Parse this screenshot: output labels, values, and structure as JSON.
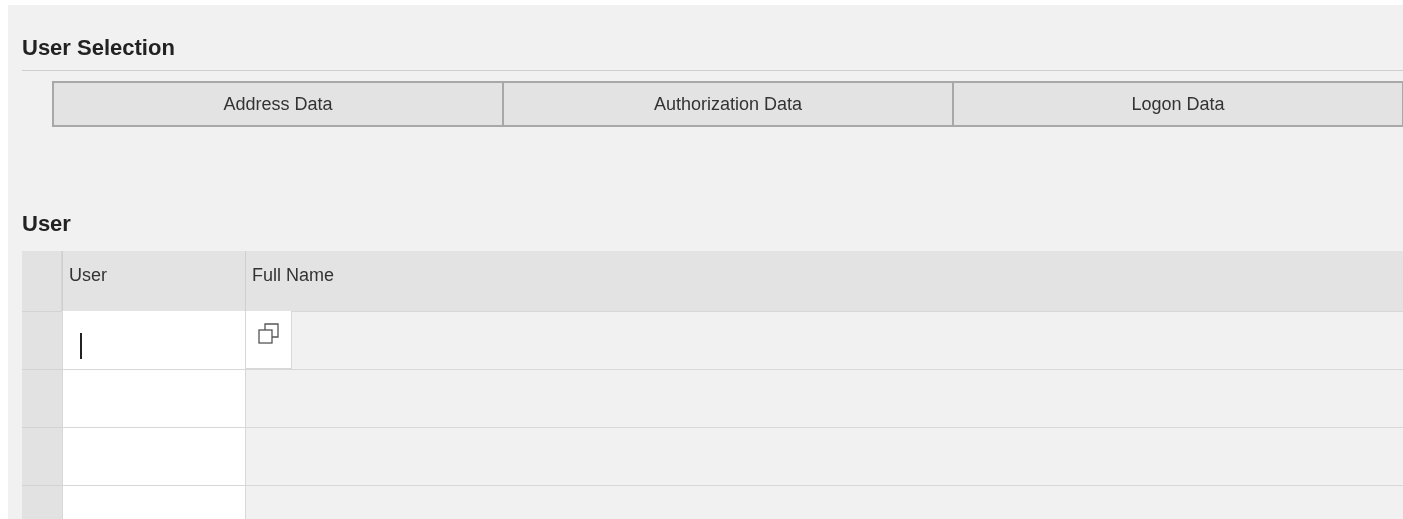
{
  "selection": {
    "title": "User Selection",
    "buttons": [
      "Address Data",
      "Authorization Data",
      "Logon Data"
    ]
  },
  "user_table": {
    "title": "User",
    "columns": [
      "User",
      "Full Name"
    ],
    "rows": [
      {
        "focused": true
      },
      {
        "focused": false
      },
      {
        "focused": false
      },
      {
        "focused": false
      }
    ]
  }
}
